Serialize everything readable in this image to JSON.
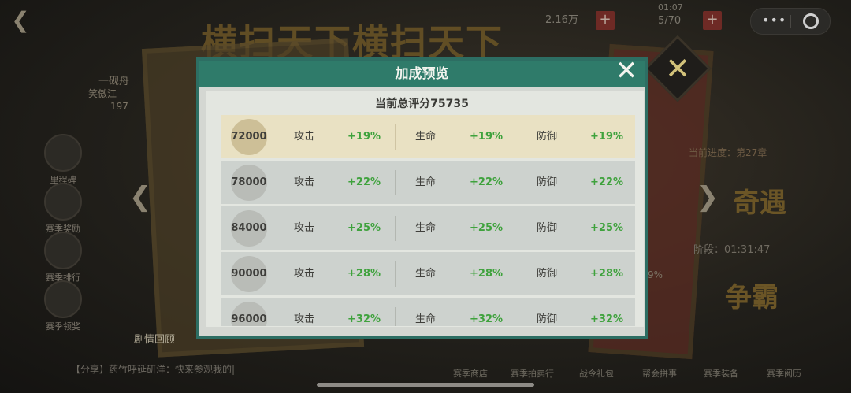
{
  "background": {
    "banner": "横扫天下横扫天下",
    "player_name": "一砚舟",
    "player_sub": "笑傲江",
    "player_power": "197",
    "top_resource_1": "2.16万",
    "top_resource_2": "5/70",
    "top_timer": "01:07",
    "side_buttons": [
      "里程碑",
      "赛季奖励",
      "赛季排行",
      "赛季领奖"
    ],
    "progress_text": "当前进度：第27章",
    "right_big_1": "奇遇",
    "right_big_2": "争霸",
    "right_timer": "阶段：01:31:47",
    "right_percent": "9%",
    "story_btn": "剧情回顾",
    "chat_text": "【分享】药竹呼延研洋：快来参观我的|",
    "bottom_tabs": [
      "赛季商店",
      "赛季拍卖行",
      "战令礼包",
      "帮会拼事",
      "赛季装备",
      "赛季阅历"
    ]
  },
  "modal": {
    "title": "加成预览",
    "subtitle": "当前总评分75735",
    "close_label": "✕",
    "stat_labels": {
      "attack": "攻击",
      "hp": "生命",
      "defense": "防御"
    },
    "rows": [
      {
        "score": "72000",
        "attack": "+19%",
        "hp": "+19%",
        "defense": "+19%"
      },
      {
        "score": "78000",
        "attack": "+22%",
        "hp": "+22%",
        "defense": "+22%"
      },
      {
        "score": "84000",
        "attack": "+25%",
        "hp": "+25%",
        "defense": "+25%"
      },
      {
        "score": "90000",
        "attack": "+28%",
        "hp": "+28%",
        "defense": "+28%"
      },
      {
        "score": "96000",
        "attack": "+32%",
        "hp": "+32%",
        "defense": "+32%"
      }
    ]
  },
  "colors": {
    "accent": "#2f7b6a",
    "positive": "#3fa23d",
    "highlight_row": "#e9e1c3"
  }
}
